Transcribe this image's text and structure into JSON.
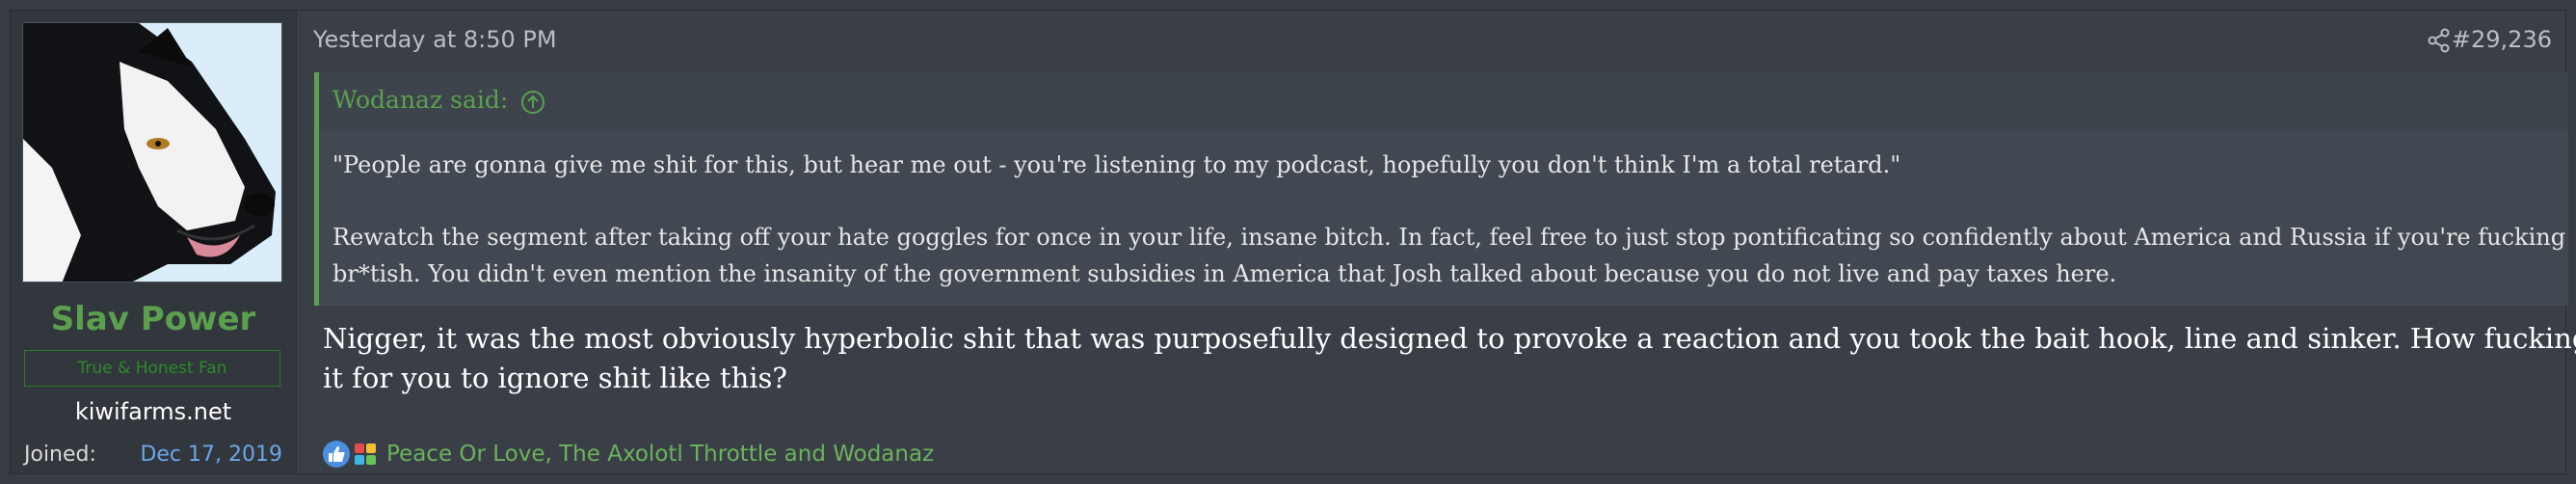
{
  "post": {
    "author": {
      "username": "Slav Power",
      "user_title": "True & Honest Fan",
      "site": "kiwifarms.net",
      "joined_label": "Joined:",
      "joined_value": "Dec 17, 2019"
    },
    "timestamp": "Yesterday at 8:50 PM",
    "post_number": "#29,236",
    "quote": {
      "author_label": "Wodanaz said:",
      "line1": "\"People are gonna give me shit for this, but hear me out - you're listening to my podcast, hopefully you don't think I'm a total retard.\"",
      "line2": "Rewatch the segment after taking off your hate goggles for once in your life, insane bitch. In fact, feel free to just stop pontificating so confidently about America and Russia if you're fucking",
      "line3": "br*tish. You didn't even mention the insanity of the government subsidies in America that Josh talked about because you do not live and pay taxes here."
    },
    "body": {
      "line1": "Nigger, it was the most obviously hyperbolic shit that was purposefully designed to provoke a reaction and you took the bait hook, line and sinker. How fucking hard is",
      "line2": "it for you to ignore shit like this?"
    },
    "reactions": {
      "icons": [
        "like-icon",
        "puzzle-icon"
      ],
      "users_text": "Peace Or Love, The Axolotl Throttle and Wodanaz"
    }
  },
  "colors": {
    "accent_green": "#5aa04e",
    "link_blue": "#6aa6e8",
    "background": "#3a3f47"
  }
}
